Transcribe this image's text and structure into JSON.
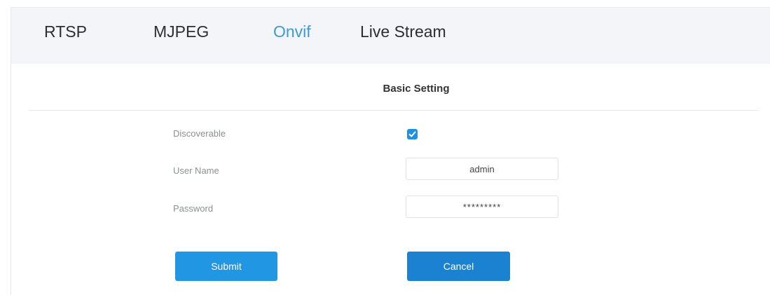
{
  "tabs": {
    "rtsp": "RTSP",
    "mjpeg": "MJPEG",
    "onvif": "Onvif",
    "live_stream": "Live Stream",
    "active": "onvif"
  },
  "section": {
    "title": "Basic Setting"
  },
  "form": {
    "discoverable_label": "Discoverable",
    "discoverable_checked": true,
    "username_label": "User Name",
    "username_value": "admin",
    "password_label": "Password",
    "password_value": "*********"
  },
  "buttons": {
    "submit": "Submit",
    "cancel": "Cancel"
  },
  "colors": {
    "accent": "#3d9ad8",
    "button": "#2196e3",
    "checkbox": "#1f8fe0"
  },
  "icons": {
    "checkbox": "check-icon"
  }
}
